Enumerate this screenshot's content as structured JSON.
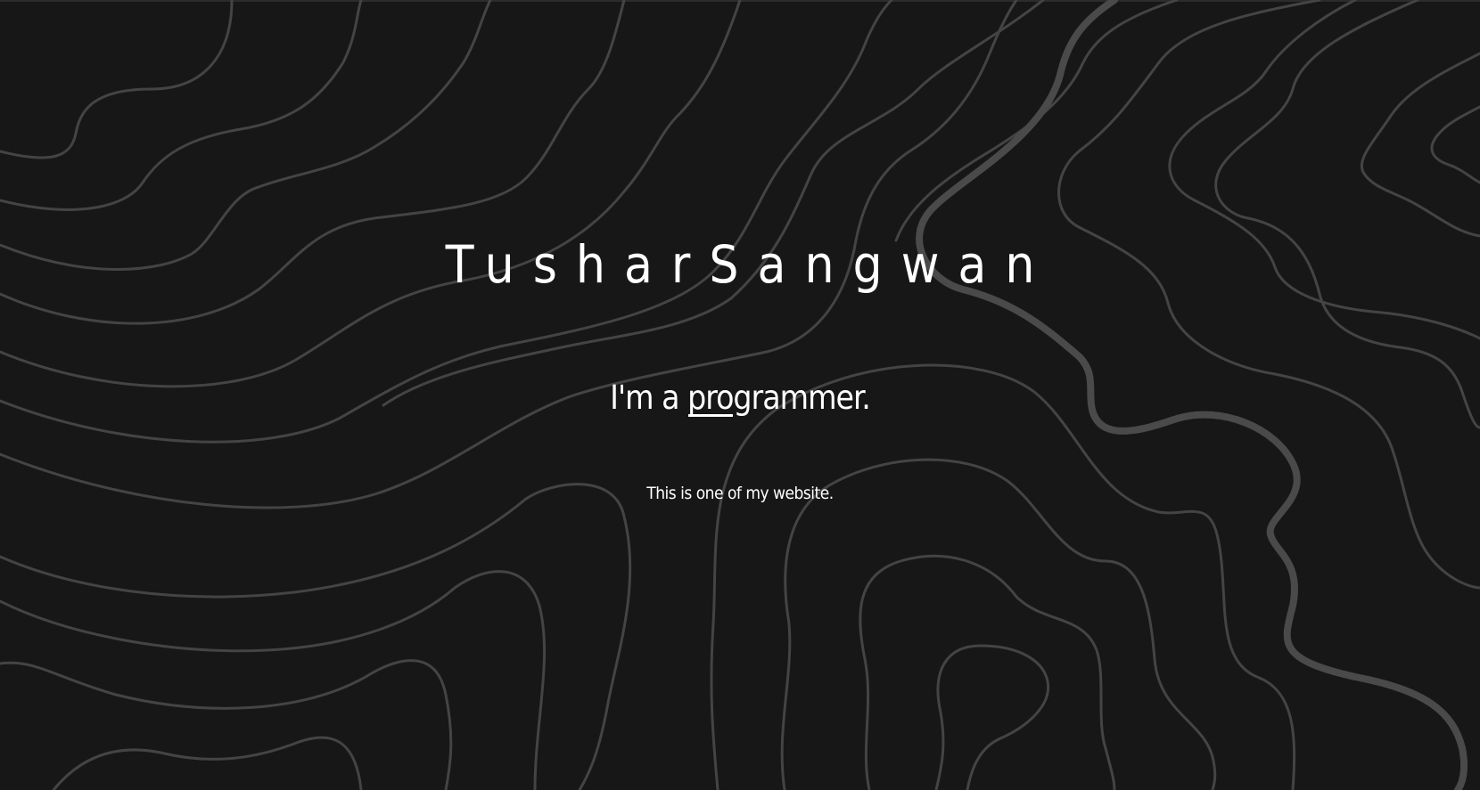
{
  "hero": {
    "name": "TusharSangwan",
    "tagline_prefix": "I'm a ",
    "tagline_typed": "programmer.",
    "subtitle": "This is one of my website."
  },
  "theme": {
    "background": "#171717",
    "contour_color": "#444444",
    "text_color": "#ffffff"
  },
  "background_pattern": "topographic-contour-lines"
}
